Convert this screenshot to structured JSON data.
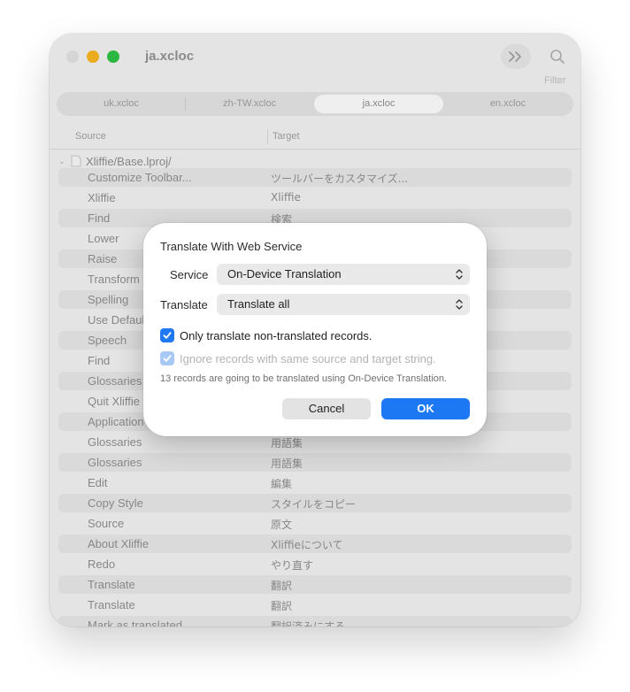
{
  "window": {
    "title": "ja.xcloc",
    "filter_label": "Filter"
  },
  "tabs": [
    {
      "label": "uk.xcloc"
    },
    {
      "label": "zh-TW.xcloc"
    },
    {
      "label": "ja.xcloc",
      "active": true
    },
    {
      "label": "en.xcloc"
    }
  ],
  "columns": {
    "source": "Source",
    "target": "Target"
  },
  "group": {
    "label": "Xliffie/Base.lproj/"
  },
  "rows": [
    {
      "source": "Customize Toolbar...",
      "target": "ツールバーをカスタマイズ..."
    },
    {
      "source": "Xliffie",
      "target": "Xliffie"
    },
    {
      "source": "Find",
      "target": "検索"
    },
    {
      "source": "Lower",
      "target": ""
    },
    {
      "source": "Raise",
      "target": ""
    },
    {
      "source": "Transform",
      "target": ""
    },
    {
      "source": "Spelling",
      "target": ""
    },
    {
      "source": "Use Default",
      "target": ""
    },
    {
      "source": "Speech",
      "target": ""
    },
    {
      "source": "Find",
      "target": ""
    },
    {
      "source": "Glossaries",
      "target": ""
    },
    {
      "source": "Quit Xliffie",
      "target": ""
    },
    {
      "source": "Application",
      "target": ""
    },
    {
      "source": "Glossaries",
      "target": "用語集"
    },
    {
      "source": "Glossaries",
      "target": "用語集"
    },
    {
      "source": "Edit",
      "target": "編集"
    },
    {
      "source": "Copy Style",
      "target": "スタイルをコピー"
    },
    {
      "source": "Source",
      "target": "原文"
    },
    {
      "source": "About Xliffie",
      "target": "Xliffieについて"
    },
    {
      "source": "Redo",
      "target": "やり直す"
    },
    {
      "source": "Translate",
      "target": "翻訳"
    },
    {
      "source": "Translate",
      "target": "翻訳"
    },
    {
      "source": "Mark as translated",
      "target": "翻訳済みにする"
    }
  ],
  "dialog": {
    "title": "Translate With Web Service",
    "service_label": "Service",
    "service_value": "On-Device Translation",
    "translate_label": "Translate",
    "translate_value": "Translate all",
    "only_non_translated_label": "Only translate non-translated records.",
    "only_non_translated_checked": true,
    "ignore_same_label": "Ignore records with same source and target string.",
    "ignore_same_checked": true,
    "ignore_same_enabled": false,
    "info": "13 records are going to be translated using On-Device Translation.",
    "cancel_label": "Cancel",
    "ok_label": "OK"
  },
  "colors": {
    "accent": "#1d78f3",
    "checkbox_disabled": "#a9c9f5"
  }
}
